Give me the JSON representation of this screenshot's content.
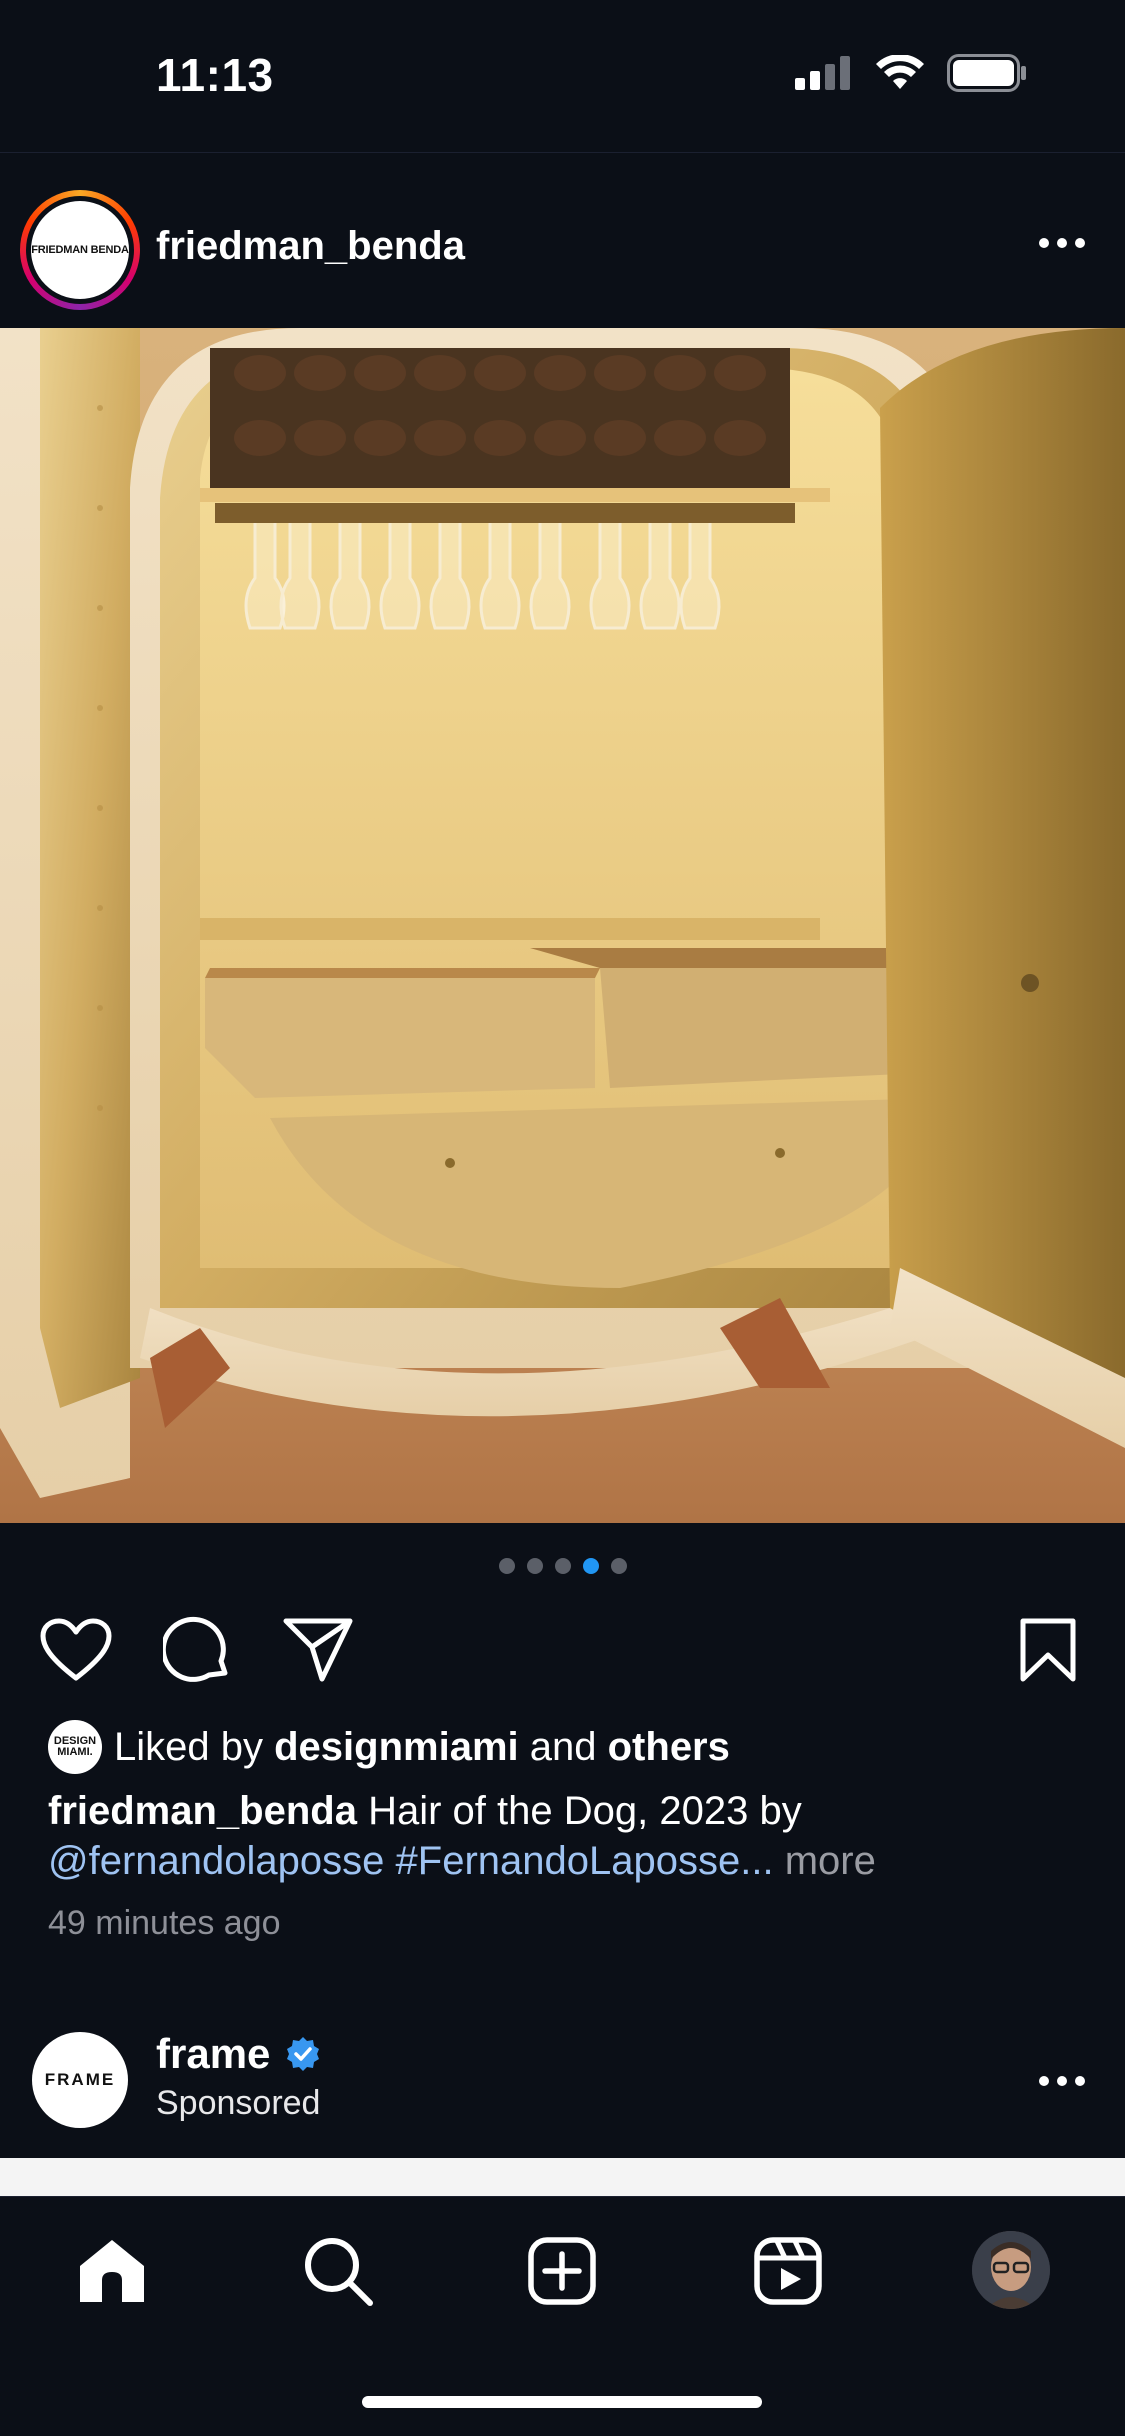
{
  "status_bar": {
    "time": "11:13"
  },
  "post": {
    "username": "friedman_benda",
    "avatar_text": "FRIEDMAN BENDA",
    "carousel": {
      "total": 5,
      "active_index": 3
    },
    "likes": {
      "avatar_text": "DESIGN MIAMI.",
      "prefix": "Liked by",
      "user": "designmiami",
      "conjunction": "and",
      "others": "others"
    },
    "caption": {
      "username": "friedman_benda",
      "text": "Hair of the Dog, 2023 by",
      "mention": "@fernandolaposse",
      "hashtag": "#FernandoLaposse",
      "ellipsis": "...",
      "more": "more"
    },
    "timestamp": "49 minutes ago"
  },
  "sponsored_post": {
    "username": "frame",
    "avatar_text": "FRAME",
    "label": "Sponsored",
    "verified": true
  },
  "tab_bar": {
    "items": [
      "home-icon",
      "search-icon",
      "create-icon",
      "reels-icon",
      "profile-avatar"
    ],
    "active": "home-icon"
  },
  "colors": {
    "background": "#0b0f17",
    "link": "#9fc3f2",
    "active_dot": "#2196f3",
    "verified": "#3897f0"
  }
}
